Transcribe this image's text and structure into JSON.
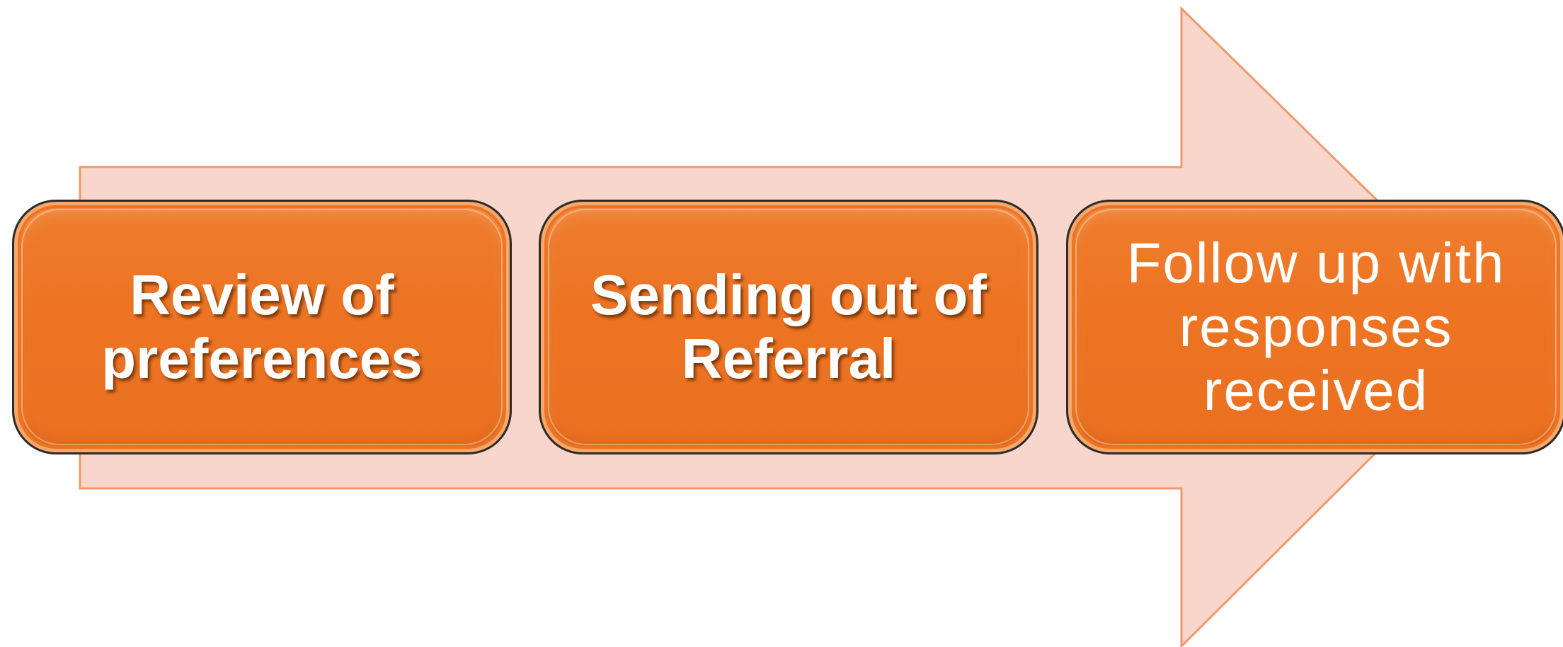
{
  "diagram": {
    "type": "process-arrow",
    "arrow_fill": "#f8d6cb",
    "arrow_stroke": "#ee9a6e",
    "box_fill": "#ec7423",
    "box_border": "#2a2a2a",
    "text_color": "#ffffff",
    "steps": [
      {
        "label_line1": "Review of",
        "label_line2": "preferences",
        "label_line3": ""
      },
      {
        "label_line1": "Sending out of",
        "label_line2": "Referral",
        "label_line3": ""
      },
      {
        "label_line1": "Follow up with",
        "label_line2": "responses",
        "label_line3": "received"
      }
    ]
  }
}
